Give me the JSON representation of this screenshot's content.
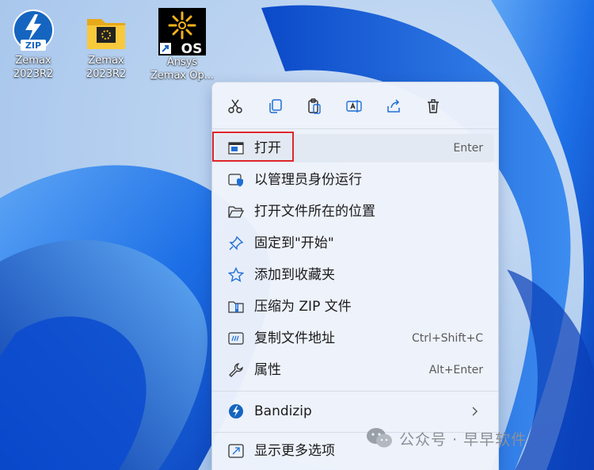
{
  "desktop": {
    "icons": [
      {
        "label_line1": "Zemax",
        "label_line2": "2023R2",
        "badge": "ZIP",
        "icon": "zip-archive-icon"
      },
      {
        "label_line1": "Zemax",
        "label_line2": "2023R2",
        "icon": "folder-icon"
      },
      {
        "label_line1": "Ansys",
        "label_line2": "Zemax Op...",
        "badge": "OS",
        "icon": "ansys-zemax-opticstudio-icon"
      }
    ]
  },
  "context_menu": {
    "toolbar": [
      {
        "icon": "cut-icon"
      },
      {
        "icon": "copy-icon"
      },
      {
        "icon": "paste-icon"
      },
      {
        "icon": "rename-icon"
      },
      {
        "icon": "share-icon"
      },
      {
        "icon": "delete-icon"
      }
    ],
    "items": [
      {
        "label": "打开",
        "shortcut": "Enter",
        "icon": "open-app-icon"
      },
      {
        "label": "以管理员身份运行",
        "shortcut": "",
        "icon": "shield-icon"
      },
      {
        "label": "打开文件所在的位置",
        "shortcut": "",
        "icon": "folder-open-icon"
      },
      {
        "label": "固定到\"开始\"",
        "shortcut": "",
        "icon": "pin-icon"
      },
      {
        "label": "添加到收藏夹",
        "shortcut": "",
        "icon": "star-icon"
      },
      {
        "label": "压缩为 ZIP 文件",
        "shortcut": "",
        "icon": "zip-folder-icon"
      },
      {
        "label": "复制文件地址",
        "shortcut": "Ctrl+Shift+C",
        "icon": "copy-path-icon"
      },
      {
        "label": "属性",
        "shortcut": "Alt+Enter",
        "icon": "wrench-icon"
      },
      {
        "label": "Bandizip",
        "shortcut": "",
        "icon": "bandizip-icon"
      },
      {
        "label": "显示更多选项",
        "shortcut": "",
        "icon": "more-options-icon"
      }
    ]
  },
  "watermark": {
    "text": "公众号 · 早早软件",
    "icon": "wechat-icon"
  },
  "colors": {
    "highlight_border": "#e0262c",
    "menu_bg": "#eef3fb",
    "accent": "#1f6fd6"
  }
}
